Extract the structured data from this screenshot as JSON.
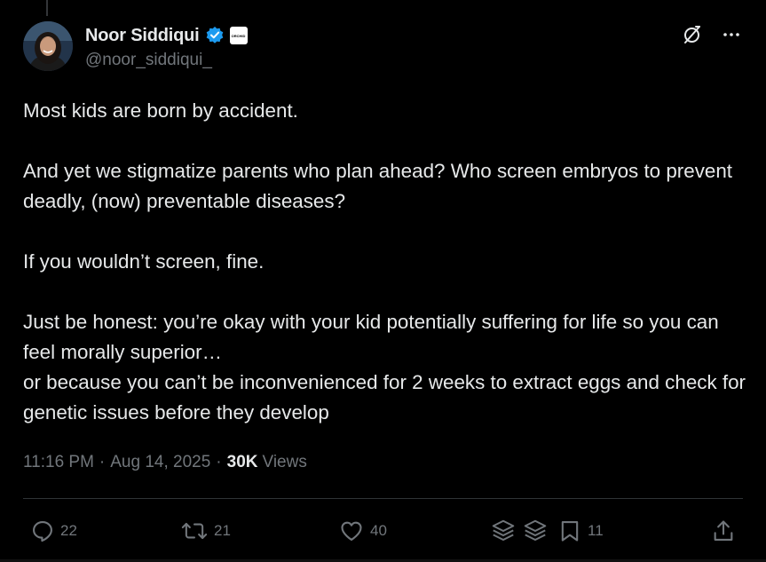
{
  "author": {
    "display_name": "Noor Siddiqui",
    "handle": "@noor_siddiqui_",
    "affiliate_badge": "ORCHID",
    "verified_color": "#1d9bf0"
  },
  "tweet": {
    "paragraphs": [
      "Most kids are born by accident.",
      "And yet we stigmatize parents who plan ahead? Who screen embryos to prevent deadly, (now) preventable diseases?",
      "If you wouldn’t screen, fine.",
      "Just be honest: you’re okay with your kid potentially suffering for life so you can feel morally superior…\nor because you can’t be inconvenienced for 2 weeks to extract eggs and check for genetic issues before they develop"
    ],
    "time": "11:16 PM",
    "date": "Aug 14, 2025",
    "views_count": "30K",
    "views_label": "Views"
  },
  "actions": {
    "replies": "22",
    "reposts": "21",
    "likes": "40",
    "bookmarks": "11"
  },
  "icons": {
    "grok": "grok-icon",
    "more": "more-icon",
    "reply": "reply-icon",
    "repost": "repost-icon",
    "like": "heart-icon",
    "stack": "layers-icon",
    "bookmark": "bookmark-icon",
    "share": "share-icon"
  },
  "colors": {
    "background": "#000000",
    "text": "#e7e9ea",
    "muted": "#71767b",
    "accent": "#1d9bf0"
  }
}
